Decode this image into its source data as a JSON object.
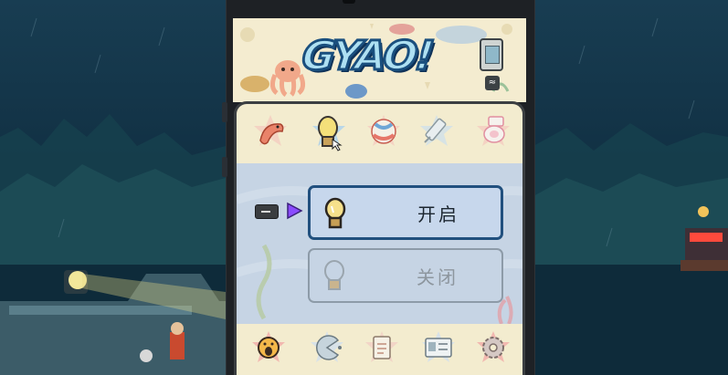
{
  "game": {
    "logo_text": "GYAO!"
  },
  "top_tabs": [
    {
      "id": "shrimp",
      "icon": "shrimp-icon"
    },
    {
      "id": "lightbulb",
      "icon": "lightbulb-icon",
      "selected": true
    },
    {
      "id": "beach-ball",
      "icon": "beach-ball-icon"
    },
    {
      "id": "syringe",
      "icon": "syringe-icon"
    },
    {
      "id": "toilet",
      "icon": "toilet-icon"
    }
  ],
  "options": {
    "on_label": "开启",
    "off_label": "关闭",
    "selected": "on"
  },
  "bottom_tabs": [
    {
      "id": "scream",
      "icon": "scream-face-icon"
    },
    {
      "id": "pacman",
      "icon": "pacman-icon"
    },
    {
      "id": "clipboard",
      "icon": "clipboard-icon"
    },
    {
      "id": "id-card",
      "icon": "id-card-icon"
    },
    {
      "id": "gear",
      "icon": "gear-icon"
    }
  ],
  "colors": {
    "panel_bg": "#f3eccf",
    "selection_border": "#21507e",
    "cursor_arrow": "#8a4bff",
    "star_badge": "#f2b8b0"
  }
}
